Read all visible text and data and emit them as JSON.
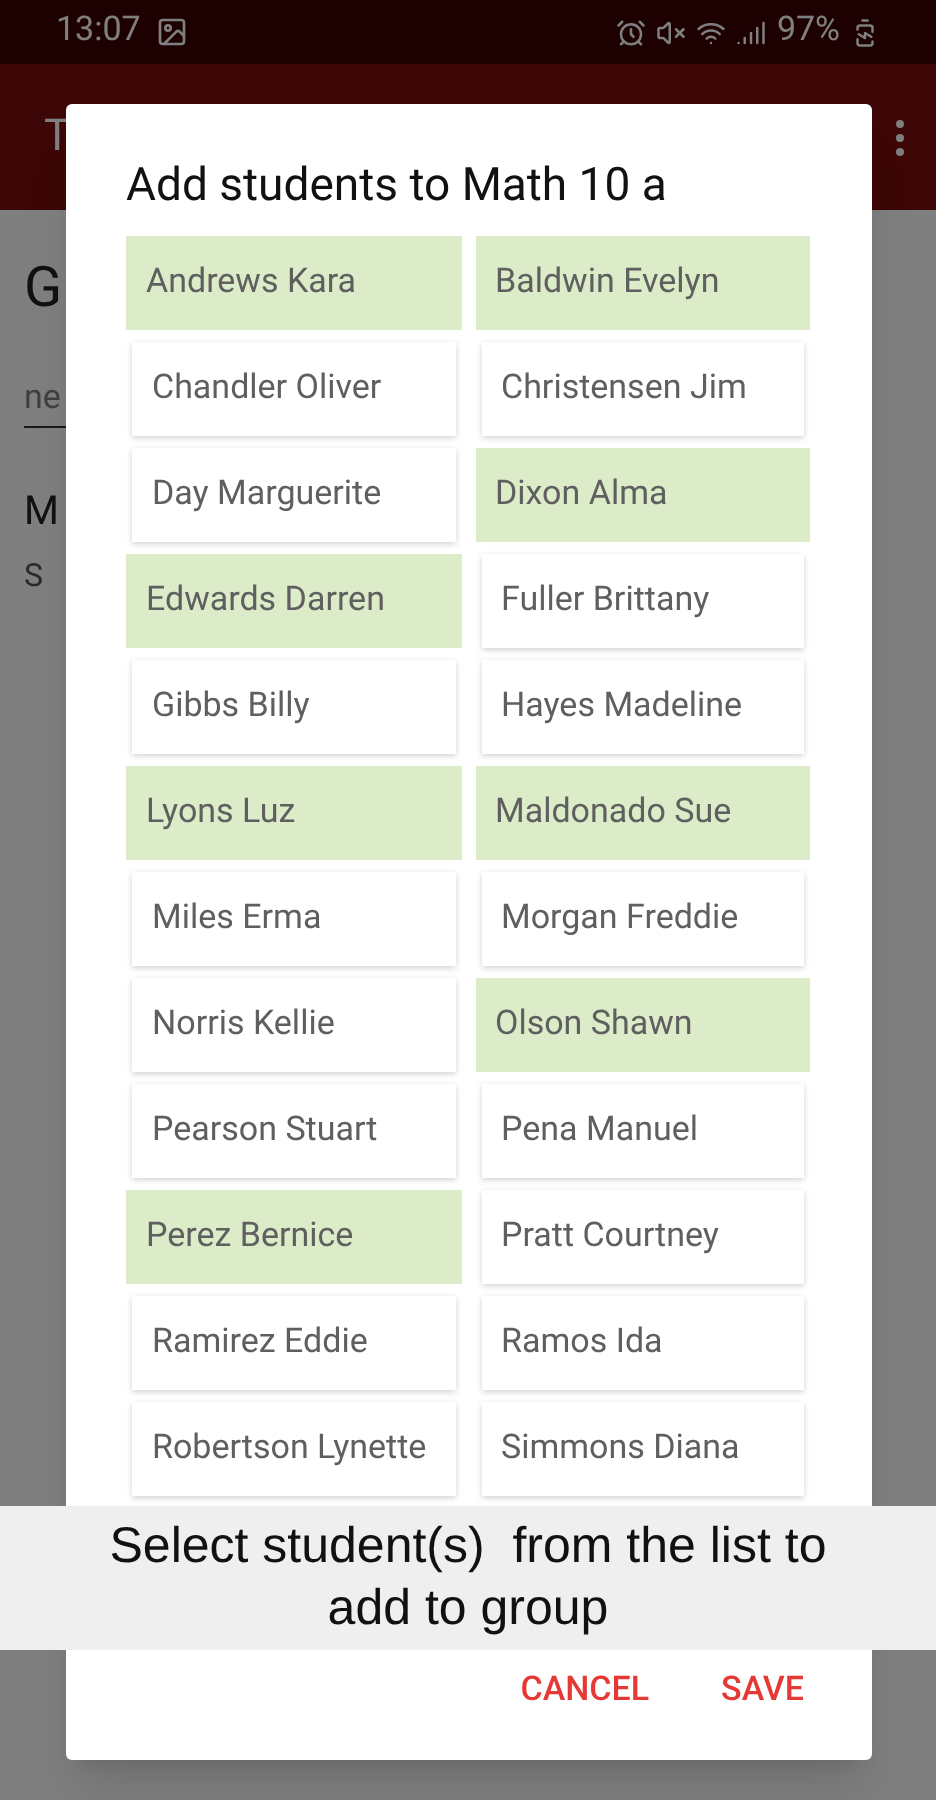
{
  "status_bar": {
    "time": "13:07",
    "battery": "97%"
  },
  "app_bar": {
    "title": "T"
  },
  "background": {
    "heading": "G",
    "field_placeholder": "ne",
    "item_title": "M",
    "item_subtitle": "S"
  },
  "dialog": {
    "title": "Add students to Math 10 a",
    "students": [
      {
        "name": "Andrews Kara",
        "selected": true
      },
      {
        "name": "Baldwin Evelyn",
        "selected": true
      },
      {
        "name": "Chandler Oliver",
        "selected": false
      },
      {
        "name": "Christensen Jim",
        "selected": false
      },
      {
        "name": "Day Marguerite",
        "selected": false
      },
      {
        "name": "Dixon Alma",
        "selected": true
      },
      {
        "name": "Edwards Darren",
        "selected": true
      },
      {
        "name": "Fuller Brittany",
        "selected": false
      },
      {
        "name": "Gibbs Billy",
        "selected": false
      },
      {
        "name": "Hayes Madeline",
        "selected": false
      },
      {
        "name": "Lyons Luz",
        "selected": true
      },
      {
        "name": "Maldonado Sue",
        "selected": true
      },
      {
        "name": "Miles Erma",
        "selected": false
      },
      {
        "name": "Morgan Freddie",
        "selected": false
      },
      {
        "name": "Norris Kellie",
        "selected": false
      },
      {
        "name": "Olson Shawn",
        "selected": true
      },
      {
        "name": "Pearson Stuart",
        "selected": false
      },
      {
        "name": "Pena Manuel",
        "selected": false
      },
      {
        "name": "Perez Bernice",
        "selected": true
      },
      {
        "name": "Pratt Courtney",
        "selected": false
      },
      {
        "name": "Ramirez Eddie",
        "selected": false
      },
      {
        "name": "Ramos Ida",
        "selected": false
      },
      {
        "name": "Robertson Lynette",
        "selected": false
      },
      {
        "name": "Simmons Diana",
        "selected": false
      }
    ],
    "buttons": [
      "CANCEL",
      "SAVE"
    ]
  },
  "caption": "Select student(s)  from the list to add to group"
}
